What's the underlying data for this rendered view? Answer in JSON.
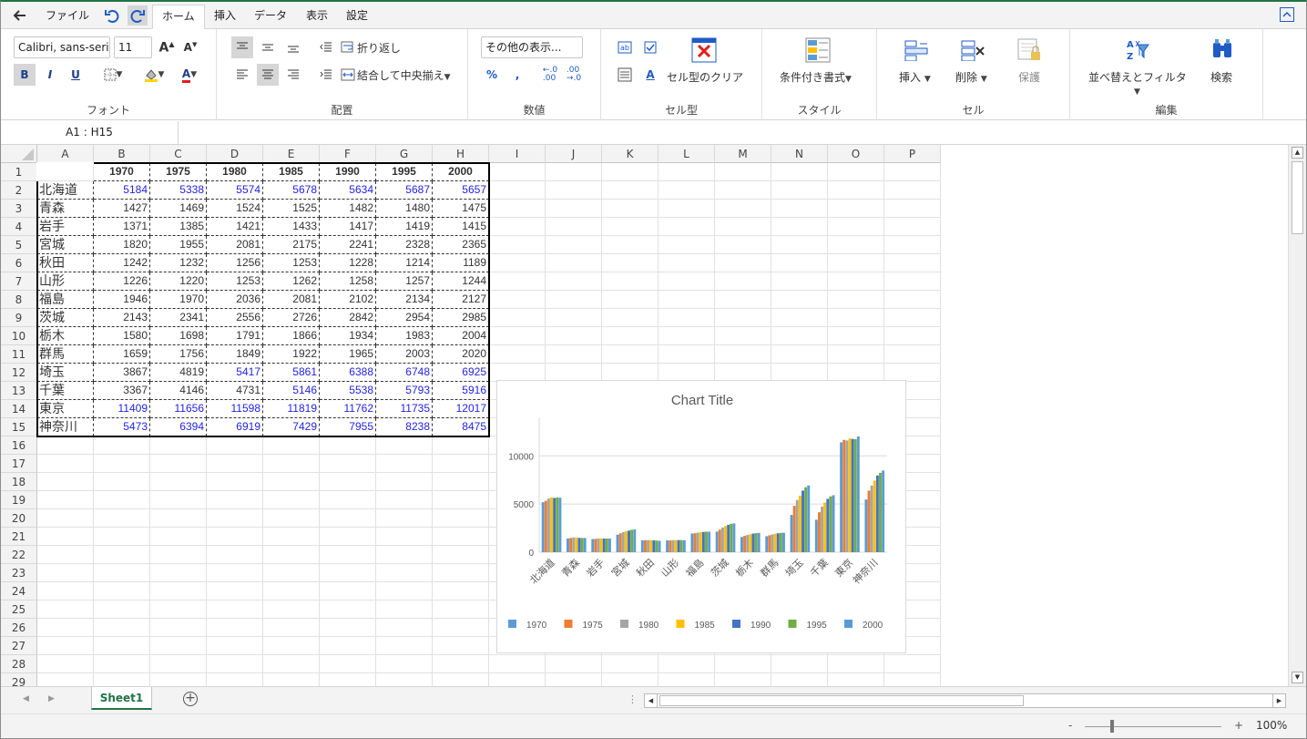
{
  "menubar": {
    "file_label": "ファイル",
    "tabs": [
      "ホーム",
      "挿入",
      "データ",
      "表示",
      "設定"
    ]
  },
  "ribbon": {
    "font": {
      "font_name": "Calibri, sans-serif",
      "font_size": "11",
      "group_label": "フォント",
      "bold": "B",
      "italic": "I",
      "underline": "U"
    },
    "alignment": {
      "wrap_label": "折り返し",
      "merge_label": "結合して中央揃え",
      "group_label": "配置"
    },
    "number": {
      "format_label": "その他の表示...",
      "percent": "%",
      "comma": ",",
      "group_label": "数値"
    },
    "celltype": {
      "clear_label": "セル型のクリア",
      "group_label": "セル型"
    },
    "style": {
      "conditional_label": "条件付き書式",
      "group_label": "スタイル"
    },
    "cells": {
      "insert_label": "挿入",
      "delete_label": "削除",
      "protect_label": "保護",
      "group_label": "セル"
    },
    "editing": {
      "sort_label": "並べ替えとフィルタ",
      "find_label": "検索",
      "group_label": "編集"
    }
  },
  "formula_bar": {
    "name_box": "A1 : H15",
    "formula": ""
  },
  "sheet": {
    "columns": [
      "A",
      "B",
      "C",
      "D",
      "E",
      "F",
      "G",
      "H",
      "I",
      "J",
      "K",
      "L",
      "M",
      "N",
      "O",
      "P"
    ],
    "header_row": [
      "1970",
      "1975",
      "1980",
      "1985",
      "1990",
      "1995",
      "2000"
    ],
    "rows": [
      {
        "name": "北海道",
        "values": [
          "5184",
          "5338",
          "5574",
          "5678",
          "5634",
          "5687",
          "5657"
        ],
        "blue": [
          1,
          1,
          1,
          1,
          1,
          1,
          1
        ]
      },
      {
        "name": "青森",
        "values": [
          "1427",
          "1469",
          "1524",
          "1525",
          "1482",
          "1480",
          "1475"
        ],
        "blue": [
          0,
          0,
          0,
          0,
          0,
          0,
          0
        ]
      },
      {
        "name": "岩手",
        "values": [
          "1371",
          "1385",
          "1421",
          "1433",
          "1417",
          "1419",
          "1415"
        ],
        "blue": [
          0,
          0,
          0,
          0,
          0,
          0,
          0
        ]
      },
      {
        "name": "宮城",
        "values": [
          "1820",
          "1955",
          "2081",
          "2175",
          "2241",
          "2328",
          "2365"
        ],
        "blue": [
          0,
          0,
          0,
          0,
          0,
          0,
          0
        ]
      },
      {
        "name": "秋田",
        "values": [
          "1242",
          "1232",
          "1256",
          "1253",
          "1228",
          "1214",
          "1189"
        ],
        "blue": [
          0,
          0,
          0,
          0,
          0,
          0,
          0
        ]
      },
      {
        "name": "山形",
        "values": [
          "1226",
          "1220",
          "1253",
          "1262",
          "1258",
          "1257",
          "1244"
        ],
        "blue": [
          0,
          0,
          0,
          0,
          0,
          0,
          0
        ]
      },
      {
        "name": "福島",
        "values": [
          "1946",
          "1970",
          "2036",
          "2081",
          "2102",
          "2134",
          "2127"
        ],
        "blue": [
          0,
          0,
          0,
          0,
          0,
          0,
          0
        ]
      },
      {
        "name": "茨城",
        "values": [
          "2143",
          "2341",
          "2556",
          "2726",
          "2842",
          "2954",
          "2985"
        ],
        "blue": [
          0,
          0,
          0,
          0,
          0,
          0,
          0
        ]
      },
      {
        "name": "栃木",
        "values": [
          "1580",
          "1698",
          "1791",
          "1866",
          "1934",
          "1983",
          "2004"
        ],
        "blue": [
          0,
          0,
          0,
          0,
          0,
          0,
          0
        ]
      },
      {
        "name": "群馬",
        "values": [
          "1659",
          "1756",
          "1849",
          "1922",
          "1965",
          "2003",
          "2020"
        ],
        "blue": [
          0,
          0,
          0,
          0,
          0,
          0,
          0
        ]
      },
      {
        "name": "埼玉",
        "values": [
          "3867",
          "4819",
          "5417",
          "5861",
          "6388",
          "6748",
          "6925"
        ],
        "blue": [
          0,
          0,
          1,
          1,
          1,
          1,
          1
        ]
      },
      {
        "name": "千葉",
        "values": [
          "3367",
          "4146",
          "4731",
          "5146",
          "5538",
          "5793",
          "5916"
        ],
        "blue": [
          0,
          0,
          0,
          1,
          1,
          1,
          1
        ]
      },
      {
        "name": "東京",
        "values": [
          "11409",
          "11656",
          "11598",
          "11819",
          "11762",
          "11735",
          "12017"
        ],
        "blue": [
          1,
          1,
          1,
          1,
          1,
          1,
          1
        ]
      },
      {
        "name": "神奈川",
        "values": [
          "5473",
          "6394",
          "6919",
          "7429",
          "7955",
          "8238",
          "8475"
        ],
        "blue": [
          1,
          1,
          1,
          1,
          1,
          1,
          1
        ]
      }
    ],
    "row_count": 29,
    "tab_name": "Sheet1"
  },
  "status": {
    "zoom": "100%",
    "zoom_minus": "-",
    "zoom_plus": "+"
  },
  "colors": {
    "accent_green": "#217346",
    "blue_text": "#2323e6",
    "series": [
      "#5b9bd5",
      "#ed7d31",
      "#a5a5a5",
      "#ffc000",
      "#4472c4",
      "#70ad47",
      "#5b9bd5"
    ]
  },
  "chart_data": {
    "type": "bar",
    "title": "Chart Title",
    "categories": [
      "北海道",
      "青森",
      "岩手",
      "宮城",
      "秋田",
      "山形",
      "福島",
      "茨城",
      "栃木",
      "群馬",
      "埼玉",
      "千葉",
      "東京",
      "神奈川"
    ],
    "series": [
      {
        "name": "1970",
        "values": [
          5184,
          1427,
          1371,
          1820,
          1242,
          1226,
          1946,
          2143,
          1580,
          1659,
          3867,
          3367,
          11409,
          5473
        ]
      },
      {
        "name": "1975",
        "values": [
          5338,
          1469,
          1385,
          1955,
          1232,
          1220,
          1970,
          2341,
          1698,
          1756,
          4819,
          4146,
          11656,
          6394
        ]
      },
      {
        "name": "1980",
        "values": [
          5574,
          1524,
          1421,
          2081,
          1256,
          1253,
          2036,
          2556,
          1791,
          1849,
          5417,
          4731,
          11598,
          6919
        ]
      },
      {
        "name": "1985",
        "values": [
          5678,
          1525,
          1433,
          2175,
          1253,
          1262,
          2081,
          2726,
          1866,
          1922,
          5861,
          5146,
          11819,
          7429
        ]
      },
      {
        "name": "1990",
        "values": [
          5634,
          1482,
          1417,
          2241,
          1228,
          1258,
          2102,
          2842,
          1934,
          1965,
          6388,
          5538,
          11762,
          7955
        ]
      },
      {
        "name": "1995",
        "values": [
          5687,
          1480,
          1419,
          2328,
          1214,
          1257,
          2134,
          2954,
          1983,
          2003,
          6748,
          5793,
          11735,
          8238
        ]
      },
      {
        "name": "2000",
        "values": [
          5657,
          1475,
          1415,
          2365,
          1189,
          1244,
          2127,
          2985,
          2004,
          2020,
          6925,
          5916,
          12017,
          8475
        ]
      }
    ],
    "yticks": [
      "0",
      "5000",
      "10000"
    ],
    "ylim": [
      0,
      14000
    ],
    "legend": "bottom",
    "grid": true
  }
}
